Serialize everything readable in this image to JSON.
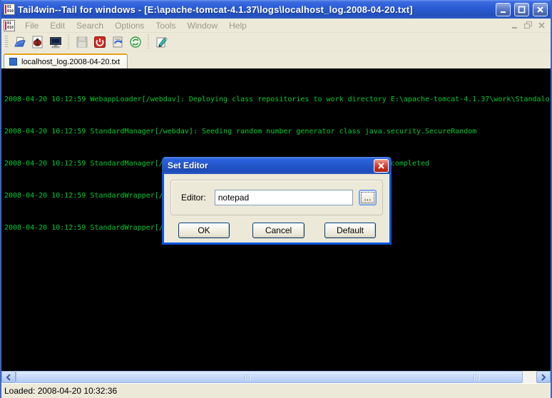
{
  "window": {
    "title": "Tail4win--Tail for windows - [E:\\apache-tomcat-4.1.37\\logs\\localhost_log.2008-04-20.txt]"
  },
  "menu": {
    "items": [
      "File",
      "Edit",
      "Search",
      "Options",
      "Tools",
      "Window",
      "Help"
    ]
  },
  "toolbar": {
    "icons": [
      "open-log-icon",
      "bug-filter-icon",
      "monitor-icon",
      "save-icon",
      "stop-icon",
      "clear-icon",
      "refresh-icon",
      "set-editor-icon"
    ]
  },
  "tab": {
    "label": "localhost_log.2008-04-20.txt"
  },
  "log": {
    "lines": [
      "2008-04-20 10:12:59 WebappLoader[/webdav]: Deploying class repositories to work directory E:\\apache-tomcat-4.1.37\\work\\Standalor",
      "2008-04-20 10:12:59 StandardManager[/webdav]: Seeding random number generator class java.security.SecureRandom",
      "2008-04-20 10:12:59 StandardManager[/webdav]: Seeding of random number generator has been completed",
      "2008-04-20 10:12:59 StandardWrapper[/webdav:default]: Loading container servlet default",
      "2008-04-20 10:12:59 StandardWrapper[/webdav:invoker]: Loading container servlet invoker"
    ],
    "text_color": "#00CC33"
  },
  "dialog": {
    "title": "Set Editor",
    "editor_label": "Editor:",
    "editor_value": "notepad",
    "browse_label": "...",
    "ok_label": "OK",
    "cancel_label": "Cancel",
    "default_label": "Default"
  },
  "statusbar": {
    "text": "Loaded: 2008-04-20 10:32:36"
  },
  "colors": {
    "titlebar_blue": "#2B5CD6",
    "dialog_frame_blue": "#0855DD",
    "window_face": "#ECE9D8",
    "log_green": "#00CC33",
    "tab_accent_orange": "#E5A01A",
    "close_red": "#C93826"
  }
}
